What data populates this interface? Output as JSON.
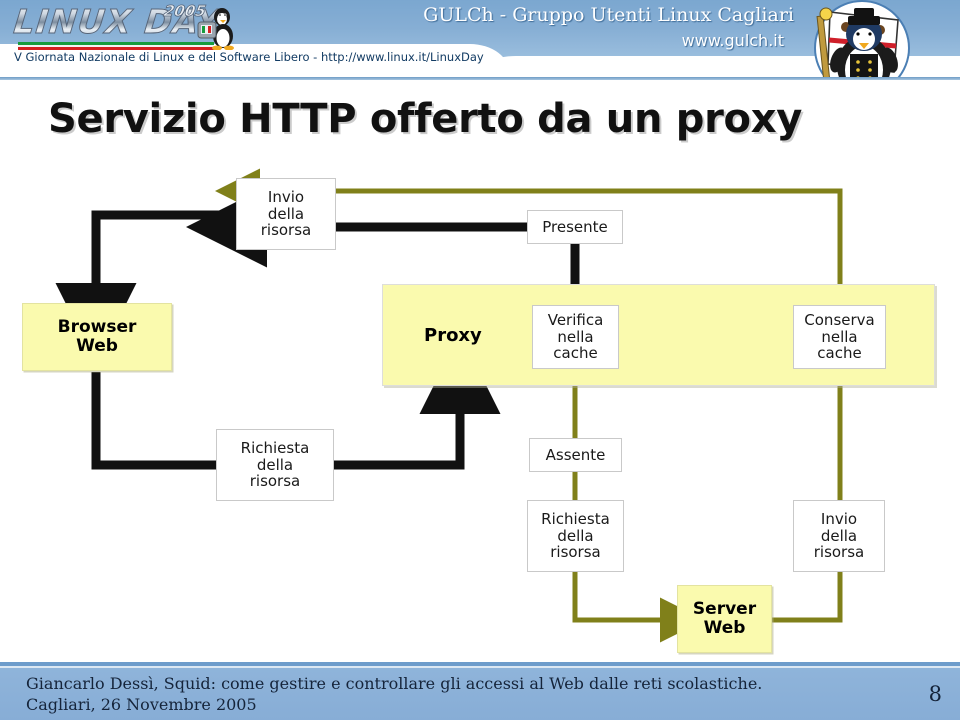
{
  "banner": {
    "logo_text": "LINUX DAY",
    "logo_year": "2005",
    "subline": "V Giornata Nazionale di Linux e del Software Libero  -  http://www.linux.it/LinuxDay",
    "gulch_title": "GULCh - Gruppo Utenti Linux Cagliari",
    "gulch_url": "www.gulch.it",
    "penguin_icon": "tux-penguin-icon",
    "mascot_icon": "sardinian-tux-mascot-icon"
  },
  "slide": {
    "title": "Servizio HTTP offerto da un proxy"
  },
  "diagram": {
    "nodes": {
      "browser_web": "Browser\nWeb",
      "proxy": "Proxy",
      "server_web": "Server\nWeb",
      "invio_top": "Invio\ndella\nrisorsa",
      "presente": "Presente",
      "verifica_cache": "Verifica\nnella\ncache",
      "conserva_cache": "Conserva\nnella\ncache",
      "richiesta_left": "Richiesta\ndella\nrisorsa",
      "assente": "Assente",
      "richiesta_bottom": "Richiesta\ndella\nrisorsa",
      "invio_bottom": "Invio\ndella\nrisorsa"
    },
    "colors": {
      "black_flow": "#111111",
      "olive_flow": "#80801a",
      "node_fill": "#fafaae",
      "label_fill": "#ffffff"
    }
  },
  "footer": {
    "line1": "Giancarlo Dessì, Squid: come gestire e controllare gli accessi al Web dalle reti scolastiche.",
    "line2": "Cagliari, 26 Novembre 2005",
    "page_number": "8"
  }
}
